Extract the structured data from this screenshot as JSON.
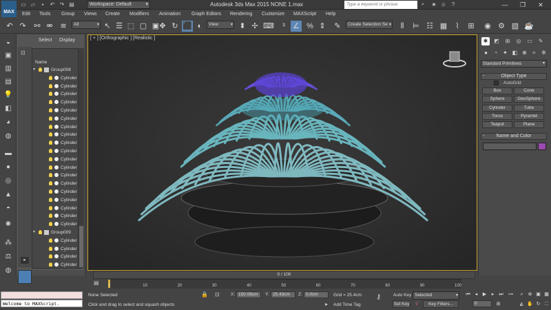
{
  "window": {
    "logo": "MAX",
    "workspace": "Workspace: Default",
    "title": "Autodesk 3ds Max  2015      NONE 1.max",
    "search_placeholder": "Type a keyword or phrase"
  },
  "menus": [
    "Edit",
    "Tools",
    "Group",
    "Views",
    "Create",
    "Modifiers",
    "Animation",
    "Graph Editors",
    "Rendering",
    "Customize",
    "MAXScript",
    "Help"
  ],
  "toolbar": {
    "selection_filter": "All",
    "reference_coord": "View",
    "selection_set": "Create Selection Se"
  },
  "scene_explorer": {
    "tabs": [
      "Select",
      "Display"
    ],
    "header": "Name",
    "groups": [
      {
        "name": "Group008",
        "children": [
          "Cylinder",
          "Cylinder",
          "Cylinder",
          "Cylinder",
          "Cylinder",
          "Cylinder",
          "Cylinder",
          "Cylinder",
          "Cylinder",
          "Cylinder",
          "Cylinder",
          "Cylinder",
          "Cylinder",
          "Cylinder",
          "Cylinder",
          "Cylinder",
          "Cylinder",
          "Cylinder",
          "Cylinder"
        ]
      },
      {
        "name": "Group009",
        "children": [
          "Cylinder",
          "Cylinder",
          "Cylinder",
          "Cylinder",
          "Cylinder",
          "Cylinder"
        ]
      }
    ]
  },
  "viewport": {
    "label": "[ + ] [Orthographic ] [Realistic ]"
  },
  "command_panel": {
    "category": "Standard Primitives",
    "object_type_title": "Object Type",
    "autogrid": "AutoGrid",
    "buttons": [
      "Box",
      "Cone",
      "Sphere",
      "GeoSphere",
      "Cylinder",
      "Tube",
      "Torus",
      "Pyramid",
      "Teapot",
      "Plane"
    ],
    "name_color_title": "Name and Color",
    "object_color": "#9a4ab0"
  },
  "timeline": {
    "slider_label": "0 / 100",
    "ticks": [
      "0",
      "10",
      "20",
      "30",
      "40",
      "50",
      "60",
      "70",
      "80",
      "90",
      "100"
    ]
  },
  "status": {
    "maxscript_output": "",
    "maxscript_input": "Welcome to MAXScript.",
    "selection": "None Selected",
    "prompt": "Click and drag to select and squash objects",
    "x_label": "X:",
    "x_value": "150.08cm",
    "y_label": "Y:",
    "y_value": "25.43cm",
    "z_label": "Z:",
    "z_value": "0.0cm",
    "grid": "Grid = 25.4cm",
    "add_time_tag": "Add Time Tag",
    "auto_key": "Auto Key",
    "set_key": "Set Key",
    "key_mode": "Selected",
    "key_filters": "Key Filters...",
    "frame": "0"
  }
}
